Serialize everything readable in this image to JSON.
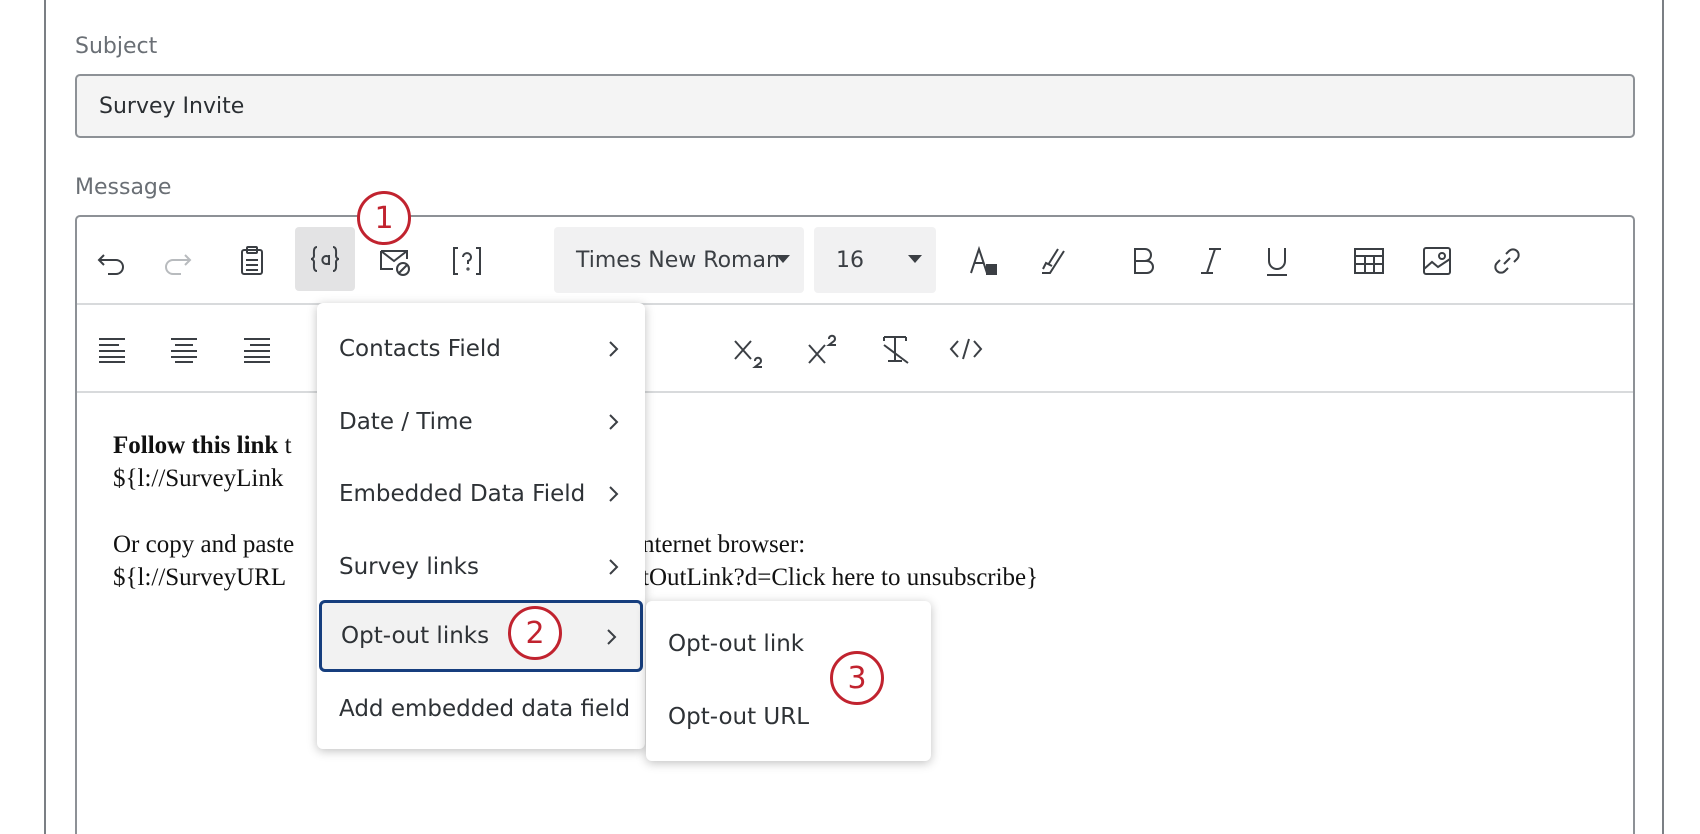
{
  "subject": {
    "label": "Subject",
    "value": "Survey Invite"
  },
  "message": {
    "label": "Message"
  },
  "toolbar": {
    "font_family": "Times New Roman",
    "font_size": "16",
    "icons": [
      "undo-icon",
      "redo-icon",
      "paste-icon",
      "piped-text-icon",
      "email-block-icon",
      "help-bracket-icon",
      "text-color-icon",
      "highlight-icon",
      "bold-icon",
      "italic-icon",
      "underline-icon",
      "table-icon",
      "image-icon",
      "link-icon",
      "align-left-icon",
      "align-center-icon",
      "align-right-icon",
      "subscript-icon",
      "superscript-icon",
      "clear-format-icon",
      "source-code-icon"
    ]
  },
  "body": {
    "line1_bold": "Follow this link",
    "line1_rest": " t",
    "line2": "${l://SurveyLink",
    "line3_left": "Or copy and paste",
    "line3_right": "nternet browser:",
    "line4_left": "${l://SurveyURL",
    "line4_right": "tOutLink?d=Click here to unsubscribe}"
  },
  "piped_text_menu": {
    "items": [
      {
        "label": "Contacts Field",
        "has_submenu": true
      },
      {
        "label": "Date / Time",
        "has_submenu": true
      },
      {
        "label": "Embedded Data Field",
        "has_submenu": true
      },
      {
        "label": "Survey links",
        "has_submenu": true
      },
      {
        "label": "Opt-out links",
        "has_submenu": true,
        "highlighted": true
      },
      {
        "label": "Add embedded data field",
        "has_submenu": false
      }
    ]
  },
  "opt_out_submenu": {
    "items": [
      {
        "label": "Opt-out link"
      },
      {
        "label": "Opt-out URL"
      }
    ]
  },
  "callouts": [
    "1",
    "2",
    "3"
  ],
  "colors": {
    "callout": "#c1232f",
    "highlight_border": "#163e7e",
    "active_button_bg": "#e3e3e4"
  }
}
